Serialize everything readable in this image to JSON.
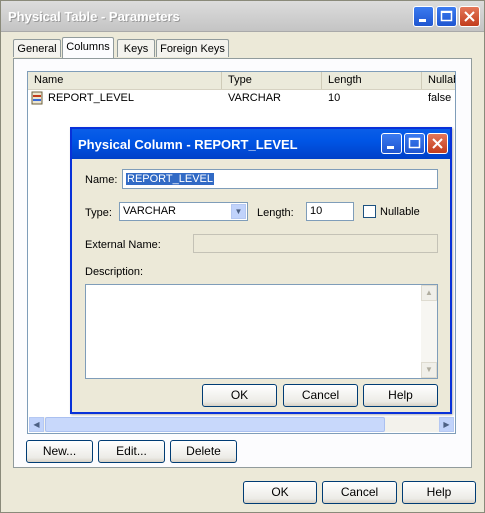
{
  "window": {
    "title": "Physical Table - Parameters"
  },
  "tabs": [
    {
      "label": "General"
    },
    {
      "label": "Columns"
    },
    {
      "label": "Keys"
    },
    {
      "label": "Foreign Keys"
    }
  ],
  "columns_list": {
    "headers": [
      "Name",
      "Type",
      "Length",
      "Nullab"
    ],
    "rows": [
      {
        "name": "REPORT_LEVEL",
        "type": "VARCHAR",
        "length": "10",
        "nullable": "false"
      }
    ]
  },
  "list_buttons": {
    "new": "New...",
    "edit": "Edit...",
    "delete": "Delete"
  },
  "dialog": {
    "title": "Physical Column - REPORT_LEVEL",
    "name_label": "Name:",
    "name_value": "REPORT_LEVEL",
    "type_label": "Type:",
    "type_value": "VARCHAR",
    "length_label": "Length:",
    "length_value": "10",
    "nullable_label": "Nullable",
    "nullable_checked": false,
    "external_name_label": "External Name:",
    "external_name_value": "",
    "description_label": "Description:",
    "description_value": "",
    "ok": "OK",
    "cancel": "Cancel",
    "help": "Help"
  },
  "footer": {
    "ok": "OK",
    "cancel": "Cancel",
    "help": "Help"
  },
  "colors": {
    "dialog_title": "#0055e5",
    "selection": "#316ac5",
    "window_title": "#c4c4c4"
  }
}
